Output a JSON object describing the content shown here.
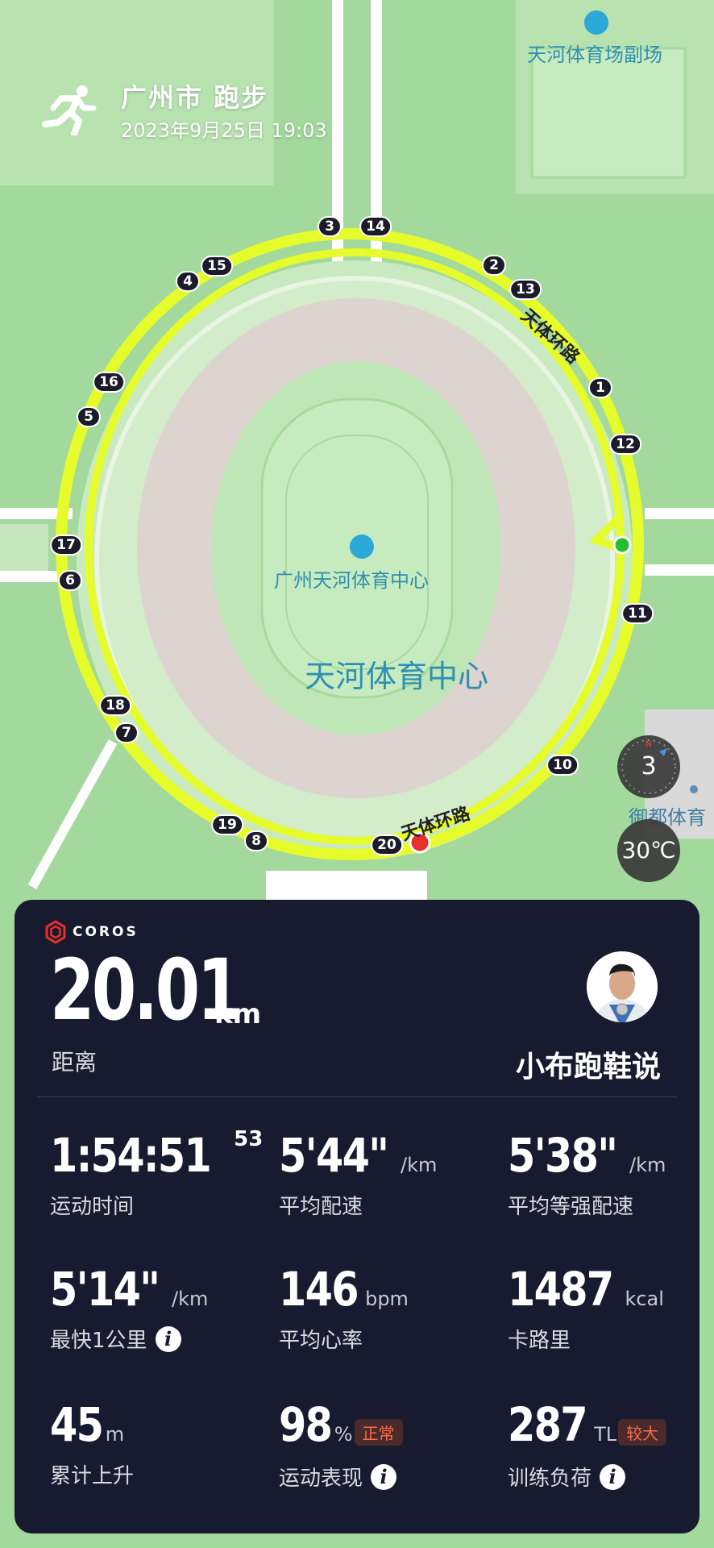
{
  "header": {
    "title": "广州市 跑步",
    "datetime": "2023年9月25日 19:03"
  },
  "map": {
    "venue_top": "天河体育场副场",
    "road_top": "天体环路",
    "road_bottom": "天体环路",
    "center_poi": "广州天河体育中心",
    "center_area": "天河体育中心",
    "right_poi": "御都体育",
    "markers": [
      "1",
      "2",
      "3",
      "4",
      "5",
      "6",
      "7",
      "8",
      "10",
      "11",
      "12",
      "13",
      "14",
      "15",
      "16",
      "17",
      "18",
      "19",
      "20"
    ]
  },
  "controls": {
    "compass_value": "3",
    "compass_north": "N",
    "temperature": "30℃"
  },
  "card": {
    "brand": "COROS",
    "distance": {
      "value": "20.01",
      "unit": "km",
      "label": "距离"
    },
    "user": {
      "name": "小布跑鞋说"
    },
    "stats": [
      {
        "value": "1:54:51",
        "sup": "53",
        "unit": "",
        "label": "运动时间"
      },
      {
        "value": "5'44\"",
        "unit": "/km",
        "label": "平均配速"
      },
      {
        "value": "5'38\"",
        "unit": "/km",
        "label": "平均等强配速"
      },
      {
        "value": "5'14\"",
        "unit": "/km",
        "label": "最快1公里"
      },
      {
        "value": "146",
        "unit": "bpm",
        "label": "平均心率"
      },
      {
        "value": "1487",
        "unit": "kcal",
        "label": "卡路里"
      },
      {
        "value": "45",
        "unit": "m",
        "label": "累计上升"
      },
      {
        "value": "98",
        "unit": "%",
        "badge": "正常",
        "label": "运动表现"
      },
      {
        "value": "287",
        "unit": "TL",
        "badge": "较大",
        "label": "训练负荷"
      }
    ],
    "info_glyph": "i"
  },
  "colors": {
    "card_bg": "#181a2f",
    "track": "#e6fb2a",
    "map_bg": "#9fd89a",
    "badge_text": "#ff6b4a"
  }
}
